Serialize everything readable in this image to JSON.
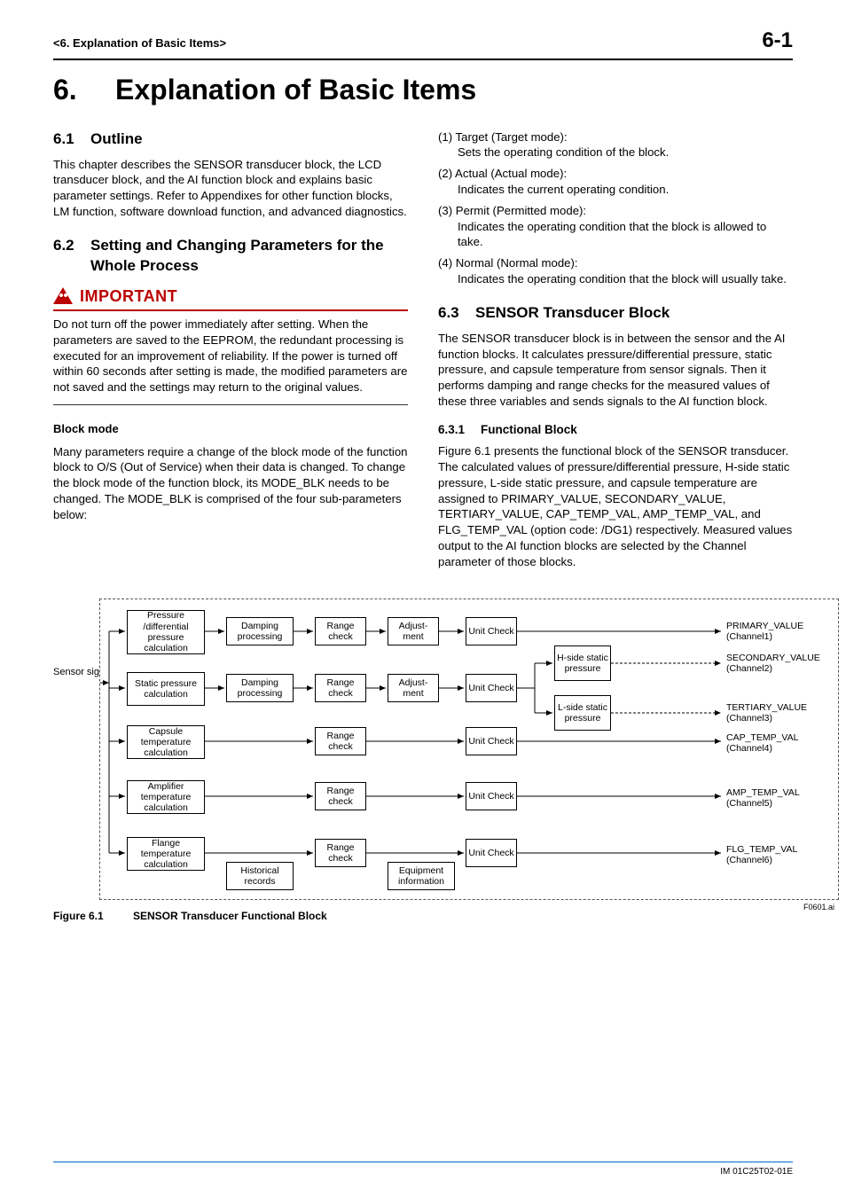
{
  "header": {
    "breadcrumb": "<6.  Explanation of Basic Items>",
    "page_num": "6-1"
  },
  "chapter": {
    "num": "6.",
    "title": "Explanation of Basic Items"
  },
  "s6_1": {
    "num": "6.1",
    "title": "Outline",
    "body": "This chapter describes the SENSOR transducer block, the LCD transducer block, and the AI function block and explains basic parameter settings. Refer to Appendixes for other function blocks, LM function, software download function, and advanced diagnostics."
  },
  "s6_2": {
    "num": "6.2",
    "title": "Setting and Changing Parameters for the Whole Process",
    "important_label": "IMPORTANT",
    "important_body": "Do not turn off the power immediately after setting. When the parameters are saved to the EEPROM, the redundant processing is executed for an improvement of reliability. If the power is turned off within 60 seconds after setting is made, the modified parameters are not saved and the settings may return to the original values.",
    "block_mode_h": "Block mode",
    "block_mode_p": "Many parameters require a change of the block mode of the function block to O/S (Out of Service) when their data is changed. To change the block mode of the function block, its MODE_BLK needs to be changed. The MODE_BLK is comprised of the four sub-parameters below:"
  },
  "modes": [
    {
      "lab": "(1) Target (Target mode):",
      "des": "Sets the operating condition of the block."
    },
    {
      "lab": "(2) Actual (Actual mode):",
      "des": "Indicates the current operating condition."
    },
    {
      "lab": "(3) Permit (Permitted mode):",
      "des": "Indicates the operating condition that the block is allowed to take."
    },
    {
      "lab": "(4) Normal (Normal mode):",
      "des": "Indicates the operating condition that the block will usually take."
    }
  ],
  "s6_3": {
    "num": "6.3",
    "title": "SENSOR Transducer Block",
    "body": "The SENSOR transducer block is in between the sensor and the AI function blocks. It calculates pressure/differential pressure, static pressure, and capsule temperature from sensor signals. Then it performs damping and range checks for the measured values of these three variables and sends signals to the AI function block."
  },
  "s6_3_1": {
    "num": "6.3.1",
    "title": "Functional Block",
    "body": "Figure 6.1 presents the functional block of the SENSOR transducer. The calculated values of pressure/differential pressure, H-side static pressure, L-side static pressure, and capsule temperature are assigned to PRIMARY_VALUE, SECONDARY_VALUE, TERTIARY_VALUE, CAP_TEMP_VAL, AMP_TEMP_VAL, and FLG_TEMP_VAL (option code: /DG1) respectively. Measured values output to the AI function blocks are selected by the Channel parameter of those blocks."
  },
  "diagram": {
    "sensor_label": "Sensor signals",
    "rows": [
      "Pressure /differential pressure calculation",
      "Static pressure calculation",
      "Capsule temperature calculation",
      "Amplifier temperature calculation",
      "Flange temperature calculation"
    ],
    "damping": "Damping processing",
    "range": "Range check",
    "adjust": "Adjust-ment",
    "unit": "Unit Check",
    "hside": "H-side static pressure",
    "lside": "L-side static pressure",
    "hist": "Historical records",
    "equip": "Equipment information",
    "outputs": [
      "PRIMARY_VALUE (Channel1)",
      "SECONDARY_VALUE (Channel2)",
      "TERTIARY_VALUE (Channel3)",
      "CAP_TEMP_VAL (Channel4)",
      "AMP_TEMP_VAL (Channel5)",
      "FLG_TEMP_VAL (Channel6)"
    ],
    "src": "F0601.ai"
  },
  "figure": {
    "num": "Figure 6.1",
    "caption": "SENSOR Transducer Functional Block"
  },
  "footer": {
    "doc": "IM 01C25T02-01E"
  }
}
